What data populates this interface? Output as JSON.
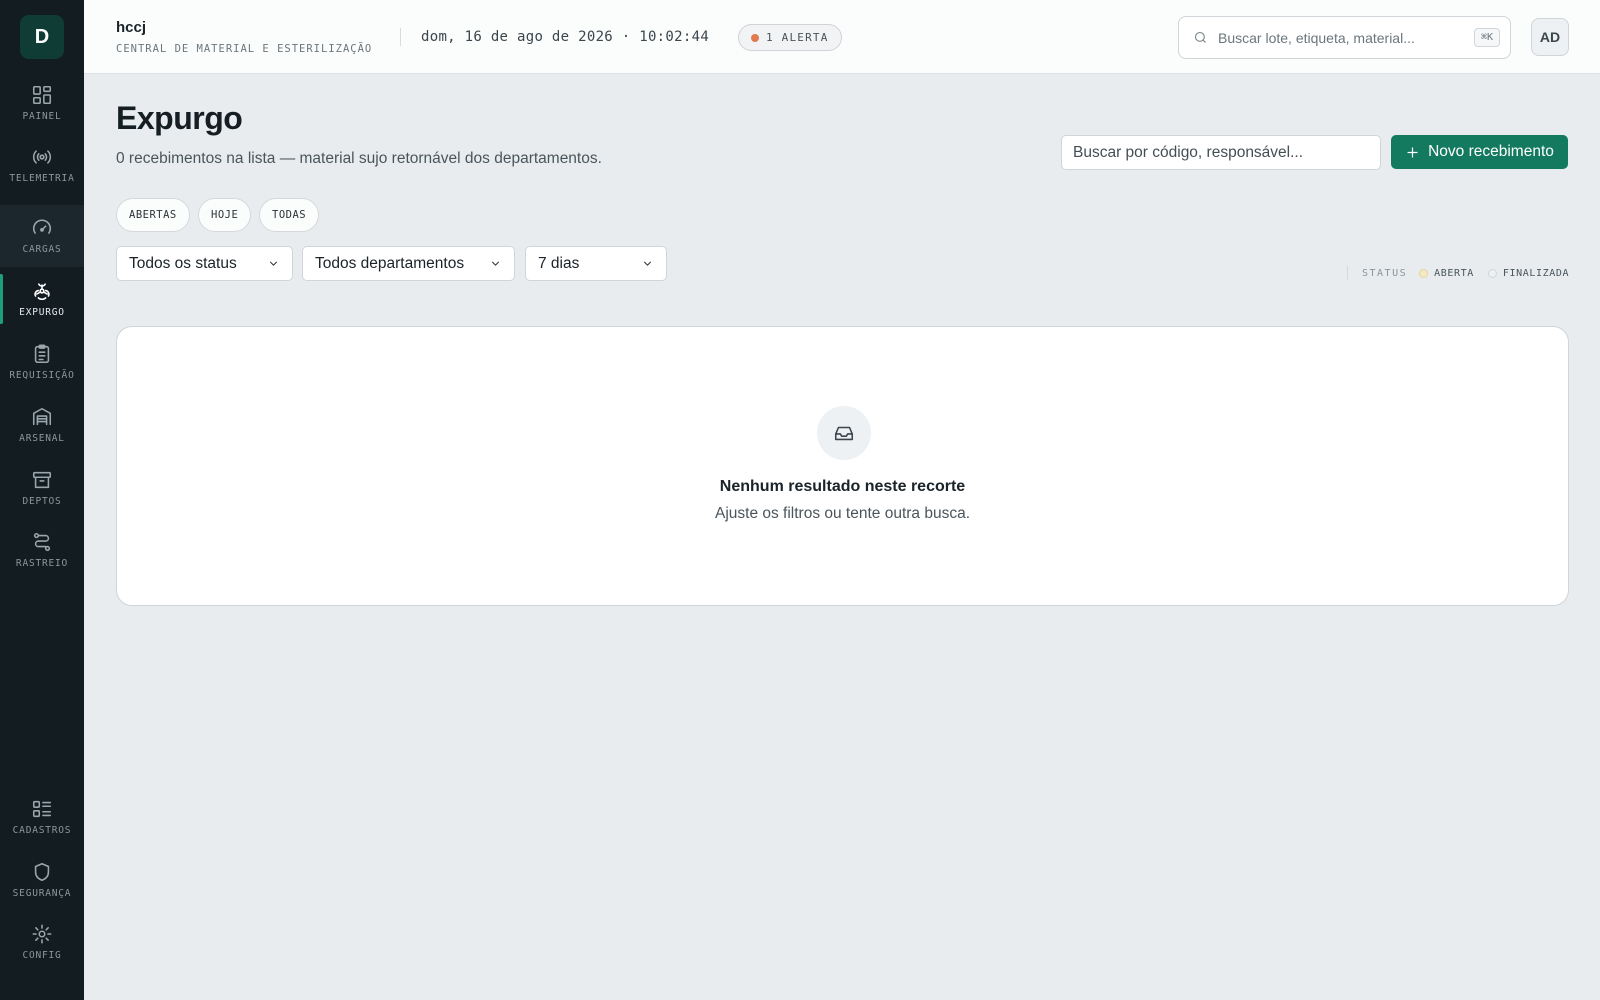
{
  "app": {
    "logo_letter": "D"
  },
  "sidebar": {
    "items": [
      {
        "label": "PAINEL",
        "icon": "grid-icon"
      },
      {
        "label": "TELEMETRIA",
        "icon": "broadcast-icon"
      },
      {
        "label": "CARGAS",
        "icon": "gauge-icon"
      },
      {
        "label": "EXPURGO",
        "icon": "biohazard-icon"
      },
      {
        "label": "REQUISIÇÃO",
        "icon": "clipboard-icon"
      },
      {
        "label": "ARSENAL",
        "icon": "warehouse-icon"
      },
      {
        "label": "DEPTOS",
        "icon": "archive-box-icon"
      },
      {
        "label": "RASTREIO",
        "icon": "route-icon"
      }
    ],
    "bottom_items": [
      {
        "label": "CADASTROS",
        "icon": "list-icon"
      },
      {
        "label": "SEGURANÇA",
        "icon": "shield-icon"
      },
      {
        "label": "CONFIG",
        "icon": "gear-icon"
      }
    ],
    "active": "EXPURGO"
  },
  "header": {
    "org_name": "hccj",
    "org_subtitle": "CENTRAL DE MATERIAL E ESTERILIZAÇÃO",
    "datetime": "dom, 16 de ago de 2026 · 10:02:44",
    "alert_label": "1 ALERTA",
    "search_placeholder": "Buscar lote, etiqueta, material...",
    "search_shortcut": "⌘K",
    "avatar_initials": "AD"
  },
  "page": {
    "title": "Expurgo",
    "subtitle": "0 recebimentos na lista — material sujo retornável dos departamentos.",
    "search_placeholder": "Buscar por código, responsável...",
    "new_button_label": "Novo recebimento"
  },
  "filters": {
    "chips": [
      "ABERTAS",
      "HOJE",
      "TODAS"
    ],
    "status_select": "Todos os status",
    "department_select": "Todos departamentos",
    "period_select": "7 dias"
  },
  "legend": {
    "title": "STATUS",
    "items": [
      {
        "label": "ABERTA",
        "color": "#f5e9c4",
        "border": "#e6d49a"
      },
      {
        "label": "FINALIZADA",
        "color": "#eef1f3",
        "border": "#cfd5d9"
      }
    ]
  },
  "empty_state": {
    "icon": "inbox-icon",
    "title": "Nenhum resultado neste recorte",
    "subtitle": "Ajuste os filtros ou tente outra busca."
  },
  "colors": {
    "sidebar_bg": "#131c21",
    "accent": "#137a5f",
    "active_indicator": "#1f9e7b",
    "alert_dot": "#e07b4d",
    "page_bg": "#e8ecef"
  }
}
